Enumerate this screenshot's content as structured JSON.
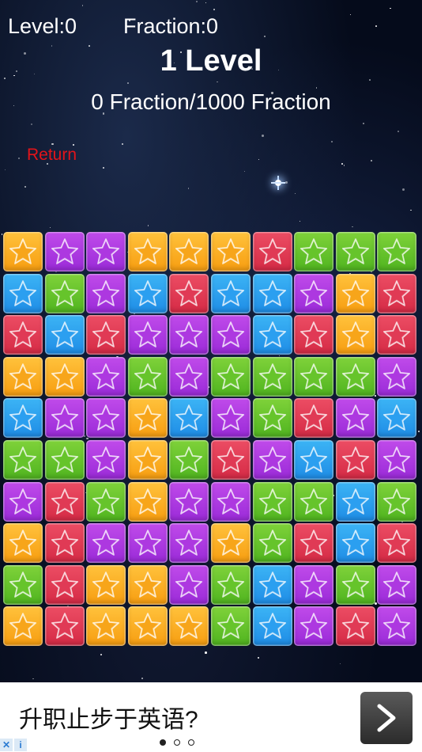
{
  "hud": {
    "level_label": "Level:0",
    "fraction_label": "Fraction:0",
    "level_title": "1 Level",
    "progress_text": "0 Fraction/1000 Fraction",
    "return_label": "Return"
  },
  "colors": {
    "orange": "#f7a51a",
    "purple": "#ad38e0",
    "red": "#e03a55",
    "green": "#66c42b",
    "blue": "#2b9ff0",
    "return": "#e2141a"
  },
  "board": {
    "columns": 10,
    "rows": 10,
    "cells": [
      [
        "orange",
        "purple",
        "purple",
        "orange",
        "orange",
        "orange",
        "red",
        "green",
        "green",
        "green"
      ],
      [
        "blue",
        "green",
        "purple",
        "blue",
        "red",
        "blue",
        "blue",
        "purple",
        "orange",
        "red"
      ],
      [
        "red",
        "blue",
        "red",
        "purple",
        "purple",
        "purple",
        "blue",
        "red",
        "orange",
        "red"
      ],
      [
        "orange",
        "orange",
        "purple",
        "green",
        "purple",
        "green",
        "green",
        "green",
        "green",
        "purple"
      ],
      [
        "blue",
        "purple",
        "purple",
        "orange",
        "blue",
        "purple",
        "green",
        "red",
        "purple",
        "blue"
      ],
      [
        "green",
        "green",
        "purple",
        "orange",
        "green",
        "red",
        "purple",
        "blue",
        "red",
        "purple"
      ],
      [
        "purple",
        "red",
        "green",
        "orange",
        "purple",
        "purple",
        "green",
        "green",
        "blue",
        "green"
      ],
      [
        "orange",
        "red",
        "purple",
        "purple",
        "purple",
        "orange",
        "green",
        "red",
        "blue",
        "red"
      ],
      [
        "green",
        "red",
        "orange",
        "orange",
        "purple",
        "green",
        "blue",
        "purple",
        "green",
        "purple"
      ],
      [
        "orange",
        "red",
        "orange",
        "orange",
        "orange",
        "green",
        "blue",
        "purple",
        "red",
        "purple"
      ]
    ]
  },
  "ad": {
    "text": "升职止步于英语?",
    "next_icon": "chevron-right-icon",
    "page_indicator": {
      "total": 3,
      "active": 1
    },
    "adchoices_icons": [
      "close-icon",
      "info-icon"
    ]
  }
}
